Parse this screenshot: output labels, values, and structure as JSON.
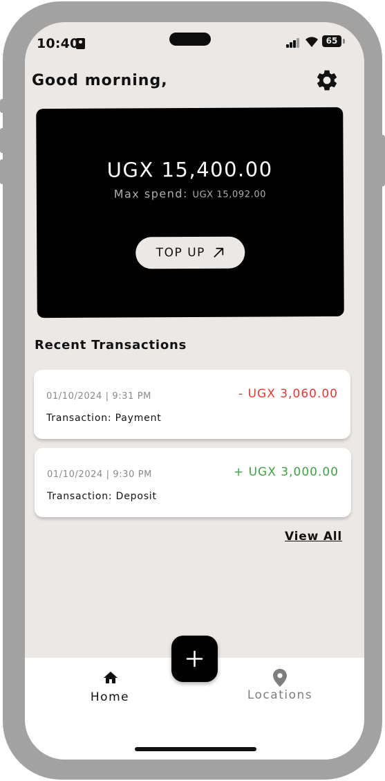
{
  "status_bar": {
    "time": "10:40",
    "battery": "65"
  },
  "header": {
    "greeting": "Good morning,",
    "settings_icon": "gear-icon"
  },
  "balance_card": {
    "balance": "UGX 15,400.00",
    "max_spend_label": "Max spend:",
    "max_spend_value": "UGX 15,092.00",
    "topup_label": "TOP UP",
    "topup_icon": "arrow-up-right-icon"
  },
  "transactions": {
    "title": "Recent Transactions",
    "items": [
      {
        "datetime": "01/10/2024 | 9:31 PM",
        "amount": "- UGX 3,060.00",
        "type": "Transaction: Payment",
        "color": "#e53935"
      },
      {
        "datetime": "01/10/2024 | 9:30 PM",
        "amount": "+ UGX 3,000.00",
        "type": "Transaction: Deposit",
        "color": "#43a047"
      }
    ],
    "view_all": "View All"
  },
  "bottom_nav": {
    "home_label": "Home",
    "home_icon": "home-icon",
    "locations_label": "Locations",
    "locations_icon": "map-pin-icon",
    "fab_icon": "plus-icon"
  }
}
